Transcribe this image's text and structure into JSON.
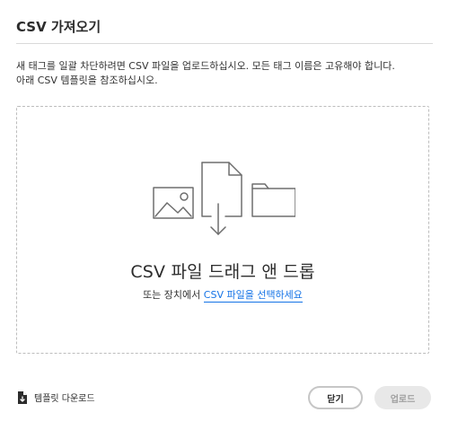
{
  "dialog": {
    "title": "CSV 가져오기",
    "description_line1": "새 태그를 일괄 차단하려면 CSV 파일을 업로드하십시오. 모든 태그 이름은 고유해야 합니다.",
    "description_line2": " 아래 CSV 템플릿을 참조하십시오."
  },
  "dropzone": {
    "title": "CSV 파일 드래그 앤 드롭",
    "or_text": "또는 장치에서 ",
    "select_link": "CSV 파일을 선택하세요",
    "icons": [
      "image-icon",
      "file-download-icon",
      "folder-icon"
    ]
  },
  "footer": {
    "template_link": "템플릿 다운로드",
    "template_icon": "document-download-icon",
    "close_label": "닫기",
    "upload_label": "업로드",
    "upload_disabled": true
  },
  "colors": {
    "link": "#1473e6",
    "border_dashed": "#bdbdbd",
    "icon": "#6e6e6e",
    "disabled_bg": "#e8e8e8"
  }
}
